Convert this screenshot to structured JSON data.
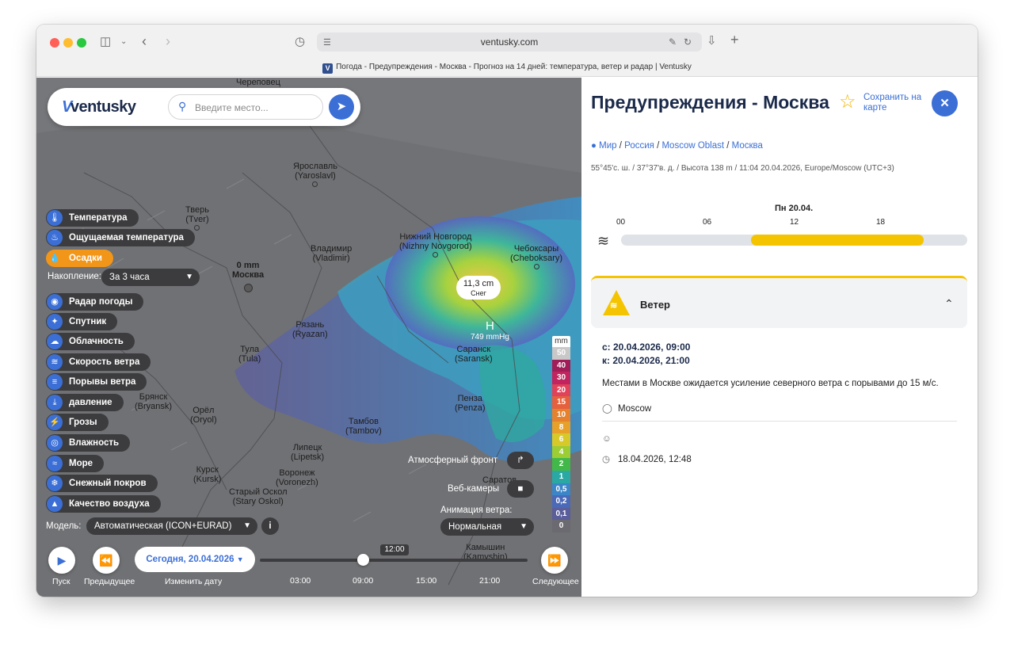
{
  "browser": {
    "url": "ventusky.com",
    "tab_title": "Погода - Предупреждения - Москва - Прогноз на 14 дней: температура, ветер и радар | Ventusky",
    "tab_favicon": "V"
  },
  "map": {
    "logo": "ventusky",
    "search_placeholder": "Введите место...",
    "cities": [
      {
        "name": "Череповец",
        "latin": ""
      },
      {
        "name": "Ярославль",
        "latin": "(Yaroslavl)"
      },
      {
        "name": "Тверь",
        "latin": "(Tver)"
      },
      {
        "name": "Владимир",
        "latin": "(Vladimir)"
      },
      {
        "name": "Нижний Новгород",
        "latin": "(Nizhny Novgorod)"
      },
      {
        "name": "Чебоксары",
        "latin": "(Cheboksary)"
      },
      {
        "name": "Рязань",
        "latin": "(Ryazan)"
      },
      {
        "name": "Тула",
        "latin": "(Tula)"
      },
      {
        "name": "Саранск",
        "latin": "(Saransk)"
      },
      {
        "name": "Брянск",
        "latin": "(Bryansk)"
      },
      {
        "name": "Орёл",
        "latin": "(Oryol)"
      },
      {
        "name": "Пенза",
        "latin": "(Penza)"
      },
      {
        "name": "Липецк",
        "latin": "(Lipetsk)"
      },
      {
        "name": "Тамбов",
        "latin": "(Tambov)"
      },
      {
        "name": "Курск",
        "latin": "(Kursk)"
      },
      {
        "name": "Воронеж",
        "latin": "(Voronezh)"
      },
      {
        "name": "Старый Оскол",
        "latin": "(Stary Oskol)"
      },
      {
        "name": "Саратов",
        "latin": ""
      },
      {
        "name": "Камышин",
        "latin": "(Kamyshin)"
      }
    ],
    "moscow": {
      "value": "0 mm",
      "name": "Москва"
    },
    "popup": {
      "value": "11,3 cm",
      "type": "Снег"
    },
    "pressure": {
      "symbol": "H",
      "value": "749 mmHg"
    },
    "layers": [
      {
        "label": "Температура",
        "icon": "thermometer-icon",
        "active": false
      },
      {
        "label": "Ощущаемая температура",
        "icon": "feels-like-icon",
        "active": false
      },
      {
        "label": "Осадки",
        "icon": "drop-icon",
        "active": true
      },
      {
        "label": "Радар погоды",
        "icon": "radar-icon",
        "active": false
      },
      {
        "label": "Спутник",
        "icon": "satellite-icon",
        "active": false
      },
      {
        "label": "Облачность",
        "icon": "cloud-icon",
        "active": false
      },
      {
        "label": "Скорость ветра",
        "icon": "wind-icon",
        "active": false
      },
      {
        "label": "Порывы ветра",
        "icon": "gust-icon",
        "active": false
      },
      {
        "label": "давление",
        "icon": "pressure-icon",
        "active": false
      },
      {
        "label": "Грозы",
        "icon": "lightning-icon",
        "active": false
      },
      {
        "label": "Влажность",
        "icon": "humidity-icon",
        "active": false
      },
      {
        "label": "Море",
        "icon": "waves-icon",
        "active": false
      },
      {
        "label": "Снежный покров",
        "icon": "snowflake-icon",
        "active": false
      },
      {
        "label": "Качество воздуха",
        "icon": "factory-icon",
        "active": false
      }
    ],
    "accumulation": {
      "label": "Накопление:",
      "value": "За 3 часа"
    },
    "model": {
      "label": "Модель:",
      "value": "Автоматическая (ICON+EURAD)"
    },
    "front_label": "Атмосферный фронт",
    "webcams_label": "Веб-камеры",
    "wind_anim": {
      "label": "Анимация ветра:",
      "value": "Нормальная"
    },
    "legend": {
      "unit": "mm",
      "steps": [
        {
          "v": "50",
          "c": "#c8c8c8"
        },
        {
          "v": "40",
          "c": "#a11d58"
        },
        {
          "v": "30",
          "c": "#c2245f"
        },
        {
          "v": "20",
          "c": "#e0425a"
        },
        {
          "v": "15",
          "c": "#e5603c"
        },
        {
          "v": "10",
          "c": "#e6822e"
        },
        {
          "v": "8",
          "c": "#e7a12a"
        },
        {
          "v": "6",
          "c": "#d8c92b"
        },
        {
          "v": "4",
          "c": "#9ccd35"
        },
        {
          "v": "2",
          "c": "#43b84a"
        },
        {
          "v": "1",
          "c": "#2aa8a4"
        },
        {
          "v": "0,5",
          "c": "#3a86c8"
        },
        {
          "v": "0,2",
          "c": "#4a69b8"
        },
        {
          "v": "0,1",
          "c": "#5a5e9a"
        },
        {
          "v": "0",
          "c": "#6a6a70"
        }
      ]
    },
    "timeline": {
      "play": "Пуск",
      "prev": "Предыдущее",
      "date": "Сегодня, 20.04.2026",
      "change_date": "Изменить дату",
      "now": "12:00",
      "ticks": [
        "03:00",
        "09:00",
        "15:00",
        "21:00"
      ],
      "next": "Следующее"
    }
  },
  "panel": {
    "title": "Предупреждения - Москва",
    "save": "Сохранить на карте",
    "breadcrumb": [
      "Мир",
      "Россия",
      "Moscow Oblast",
      "Москва"
    ],
    "meta": "55°45'с. ш. / 37°37'в. д. / Высота 138 m / 11:04 20.04.2026, Europe/Moscow (UTC+3)",
    "day": "Пн 20.04.",
    "hours": [
      "00",
      "06",
      "12",
      "18"
    ],
    "warning_bar": {
      "from_hour": 9,
      "to_hour": 21,
      "color": "#f5c400"
    },
    "card_title": "Ветер",
    "from": "с: 20.04.2026, 09:00",
    "to": "к: 20.04.2026, 21:00",
    "description": "Местами в Москве ожидается усиление северного ветра с порывами до 15 м/с.",
    "location": "Moscow",
    "issued": "18.04.2026, 12:48"
  }
}
